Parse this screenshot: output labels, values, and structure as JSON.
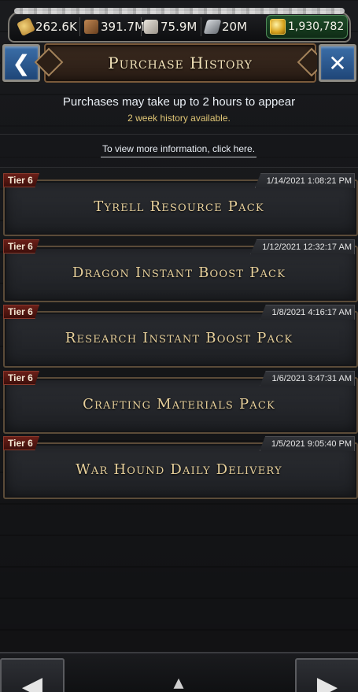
{
  "resources": {
    "food": {
      "icon": "wheat-icon",
      "value": "262.6K"
    },
    "wood": {
      "icon": "wood-icon",
      "value": "391.7M"
    },
    "stone": {
      "icon": "stone-icon",
      "value": "75.9M"
    },
    "iron": {
      "icon": "iron-icon",
      "value": "20M"
    },
    "gold": {
      "icon": "gold-coin-icon",
      "value": "1,930,782"
    }
  },
  "header": {
    "title": "Purchase History",
    "back_icon": "❮",
    "close_icon": "✕"
  },
  "info": {
    "notice": "Purchases may take up to 2 hours to appear",
    "history_note": "2 week history available.",
    "more_info_link": "To view more information, click here."
  },
  "purchases": [
    {
      "tier": "Tier 6",
      "timestamp": "1/14/2021 1:08:21 PM",
      "name": "Tyrell Resource Pack"
    },
    {
      "tier": "Tier 6",
      "timestamp": "1/12/2021 12:32:17 AM",
      "name": "Dragon Instant Boost Pack"
    },
    {
      "tier": "Tier 6",
      "timestamp": "1/8/2021 4:16:17 AM",
      "name": "Research Instant Boost Pack"
    },
    {
      "tier": "Tier 6",
      "timestamp": "1/6/2021 3:47:31 AM",
      "name": "Crafting Materials Pack"
    },
    {
      "tier": "Tier 6",
      "timestamp": "1/5/2021 9:05:40 PM",
      "name": "War Hound Daily Delivery"
    }
  ],
  "colors": {
    "tier_tag": "#6a1f18",
    "item_title": "#e8d19c",
    "history_note": "#e0c676",
    "header_button": "#2f5d96"
  }
}
